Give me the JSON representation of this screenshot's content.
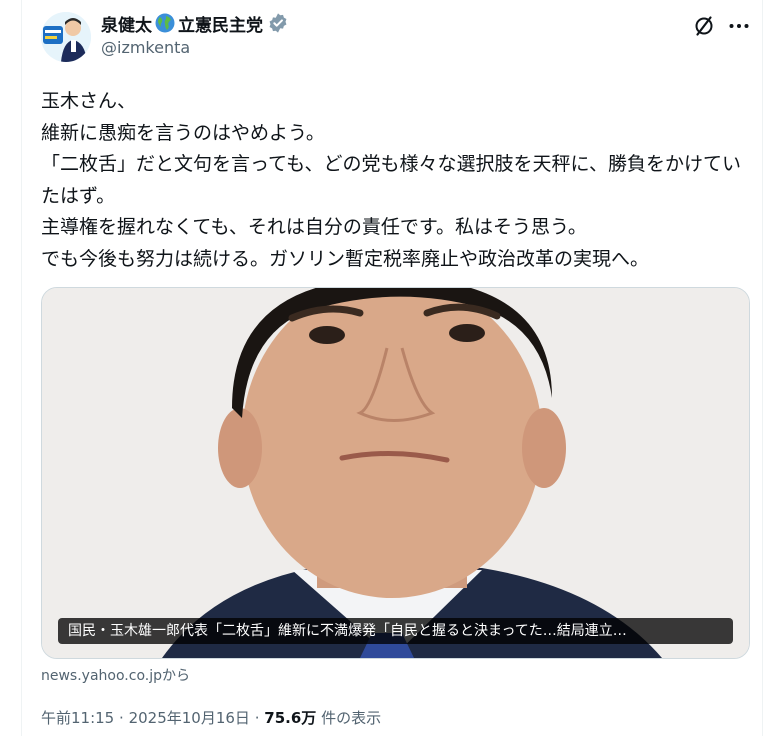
{
  "author": {
    "name_before_icon": "泉健太",
    "name_after_icon": "立憲民主党",
    "handle": "@izmkenta",
    "icons": [
      "globe-emoji-icon",
      "verified-badge-icon"
    ]
  },
  "header_actions": {
    "grok_icon": "grok-icon",
    "more_icon": "more-icon"
  },
  "tweet": {
    "text": "玉木さん、\n維新に愚痴を言うのはやめよう。\n「二枚舌」だと文句を言っても、どの党も様々な選択肢を天秤に、勝負をかけていたはず。\n主導権を握れなくても、それは自分の責任です。私はそう思う。\nでも今後も努力は続ける。ガソリン暫定税率廃止や政治改革の実現へ。"
  },
  "link_card": {
    "caption": "国民・玉木雄一郎代表「二枚舌」維新に不満爆発「自民と握ると決まってた…結局連立…",
    "source": "news.yahoo.co.jpから"
  },
  "meta": {
    "time": "午前11:15",
    "separator": "·",
    "date": "2025年10月16日",
    "views": "75.6万",
    "views_label": "件の表示"
  },
  "colors": {
    "text": "#0f1419",
    "secondary": "#536471",
    "verified": "#829aab",
    "border": "#cfd9de"
  }
}
